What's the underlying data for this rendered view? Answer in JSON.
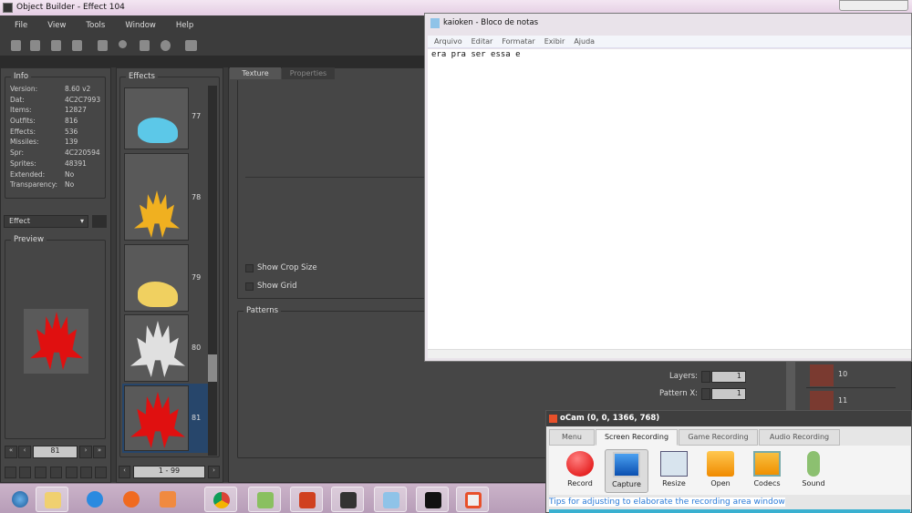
{
  "app": {
    "title": "Object Builder - Effect 104",
    "menu": [
      "File",
      "View",
      "Tools",
      "Window",
      "Help"
    ]
  },
  "info": {
    "title": "Info",
    "rows": [
      {
        "k": "Version:",
        "v": "8.60 v2"
      },
      {
        "k": "Dat:",
        "v": "4C2C7993"
      },
      {
        "k": "Items:",
        "v": "12827"
      },
      {
        "k": "Outfits:",
        "v": "816"
      },
      {
        "k": "Effects:",
        "v": "536"
      },
      {
        "k": "Missiles:",
        "v": "139"
      },
      {
        "k": "Spr:",
        "v": "4C220594"
      },
      {
        "k": "Sprites:",
        "v": "48391"
      },
      {
        "k": "Extended:",
        "v": "No"
      },
      {
        "k": "Transparency:",
        "v": "No"
      }
    ]
  },
  "category_select": "Effect",
  "preview": {
    "title": "Preview",
    "current": "81"
  },
  "effects": {
    "title": "Effects",
    "items": [
      {
        "id": "77",
        "color": "#5cc8e8"
      },
      {
        "id": "78",
        "color": "#f0b020"
      },
      {
        "id": "79",
        "color": "#f0d060"
      },
      {
        "id": "80",
        "color": "#e0e0e0"
      },
      {
        "id": "81",
        "color": "#e01010"
      }
    ],
    "selected": "81",
    "range": "1 - 99"
  },
  "tabs": {
    "texture": "Texture",
    "properties": "Properties"
  },
  "texture": {
    "show_crop_size": "Show Crop Size",
    "show_grid": "Show Grid",
    "patterns": "Patterns",
    "layers_label": "Layers:",
    "layers": "1",
    "pattern_x_label": "Pattern X:",
    "pattern_x": "1"
  },
  "sprite_list": [
    "10",
    "11"
  ],
  "notepad": {
    "title": "kaioken - Bloco de notas",
    "menu": [
      "Arquivo",
      "Editar",
      "Formatar",
      "Exibir",
      "Ajuda"
    ],
    "text": "era pra ser essa e"
  },
  "ocam": {
    "title": "oCam (0, 0, 1366, 768)",
    "tabs": [
      "Menu",
      "Screen Recording",
      "Game Recording",
      "Audio Recording"
    ],
    "active_tab": "Screen Recording",
    "tools": [
      "Record",
      "Capture",
      "Resize",
      "Open",
      "Codecs",
      "Sound"
    ],
    "tip": "Tips for adjusting to elaborate the recording area window"
  },
  "taskbar": [
    "start",
    "explorer",
    "internet-explorer",
    "firefox",
    "media-player",
    "chrome",
    "notepad-plus",
    "game-client",
    "object-builder",
    "notepad",
    "cmd",
    "ocam"
  ]
}
